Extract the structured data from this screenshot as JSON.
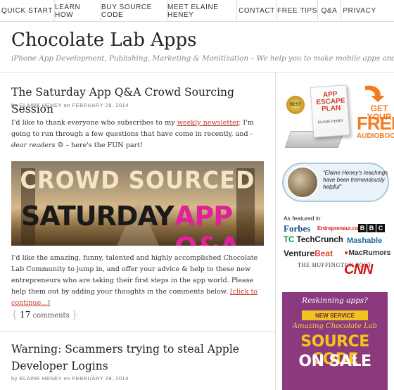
{
  "nav": {
    "items": [
      "QUICK START",
      "LEARN HOW",
      "BUY SOURCE CODE",
      "MEET ELAINE HENEY",
      "CONTACT",
      "FREE TIPS",
      "Q&A",
      "PRIVACY"
    ]
  },
  "header": {
    "title": "Chocolate Lab Apps",
    "description": "iPhone App Development, Publishing, Marketing & Monitization – We help you to make mobile apps and hack your life."
  },
  "posts": [
    {
      "title": "The Saturday App Q&A Crowd Sourcing Session",
      "by": "by",
      "author": "ELAINE HENEY",
      "on": "on",
      "date": "FEBRUARY 28, 2014",
      "intro_1": "I'd like to thank everyone who subscribes to my ",
      "intro_link": "weekly newsletter",
      "intro_2": ". I'm going to run through a few questions that have come in recently, and - ",
      "intro_em": "dear readers",
      "intro_3": " – here's the FUN part!",
      "banner": {
        "line1": "CROWD SOURCED",
        "line2": "SATURDAY",
        "line3": "APP Q&A"
      },
      "body": "I'd like the amazing, funny, talented and highly accomplished Chocolate Lab Community to jump in, and offer your advice & help to these new entrepreneurs who are taking their first steps in the app world. Please help them out by adding your thoughts in the comments below. ",
      "continue": "[click to continue...]",
      "comments_count": "17",
      "comments_label": "comments"
    },
    {
      "title": "Warning: Scammers trying to steal Apple Developer Logins",
      "by": "by",
      "author": "ELAINE HENEY",
      "on": "on",
      "date": "FEBRUARY 28, 2014"
    }
  ],
  "sidebar": {
    "book_ad": {
      "badge": "BEST",
      "book_title": "APP ESCAPE PLAN",
      "book_author": "ELAINE HENEY",
      "cta1": "GET YOUR",
      "cta2": "FREE",
      "cta3": "AUDIOBOOK"
    },
    "testimonial": "“Elaine Heney's teachings have been tremendously helpful”",
    "featured_label": "As featured in:",
    "logos": {
      "forbes": "Forbes",
      "entrepreneur": "Entrepreneur.com",
      "bbc": [
        "B",
        "B",
        "C"
      ],
      "techcrunch_mark": "TC",
      "techcrunch": "TechCrunch",
      "mashable": "Mashable",
      "venture": "Venture",
      "beat": "Beat",
      "macrumors": "MacRumors",
      "huffington": "THE HUFFINGTON POST",
      "cnn": "CNN"
    },
    "source_ad": {
      "question": "Reskinning apps?",
      "ribbon": "NEW SERVICE",
      "amazing": "Amazing Chocolate Lab",
      "line1": "SOURCE CODE",
      "line2": "ON SALE"
    }
  },
  "colors": {
    "link": "#c0392b",
    "accent_orange": "#f47c20",
    "source_ad_bg": "#8b3a7e",
    "banner_pink": "#e0219a"
  }
}
